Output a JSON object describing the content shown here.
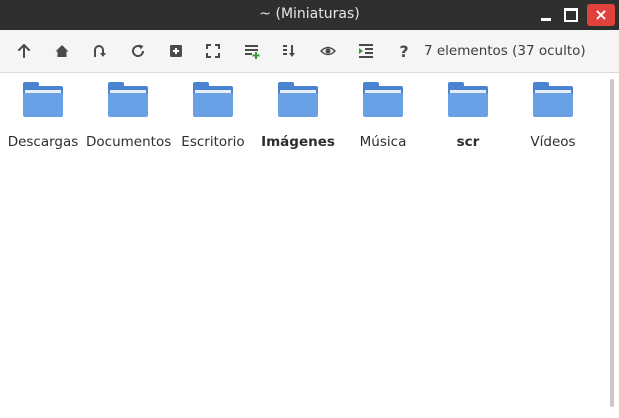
{
  "window": {
    "title": "~ (Miniaturas)",
    "controls": {
      "close_glyph": "×"
    }
  },
  "toolbar": {
    "buttons": [
      {
        "name": "up-button",
        "icon": "arrow-up-icon"
      },
      {
        "name": "home-button",
        "icon": "home-icon"
      },
      {
        "name": "go-back-button",
        "icon": "undo-arrow-icon"
      },
      {
        "name": "reload-button",
        "icon": "reload-icon"
      },
      {
        "name": "new-folder-button",
        "icon": "plus-square-icon"
      },
      {
        "name": "fullscreen-button",
        "icon": "fullscreen-icon"
      },
      {
        "name": "add-bookmark-button",
        "icon": "list-add-icon"
      },
      {
        "name": "sort-button",
        "icon": "sort-down-icon"
      },
      {
        "name": "show-hidden-button",
        "icon": "eye-icon"
      },
      {
        "name": "side-pane-button",
        "icon": "indent-icon"
      },
      {
        "name": "help-button",
        "icon": "question-icon",
        "glyph": "?"
      }
    ],
    "status": "7 elementos (37 oculto)"
  },
  "items": [
    {
      "label": "Descargas",
      "bold": false,
      "icon": "folder-icon"
    },
    {
      "label": "Documentos",
      "bold": false,
      "icon": "folder-icon"
    },
    {
      "label": "Escritorio",
      "bold": false,
      "icon": "folder-icon"
    },
    {
      "label": "Imágenes",
      "bold": true,
      "icon": "folder-icon"
    },
    {
      "label": "Música",
      "bold": false,
      "icon": "folder-icon"
    },
    {
      "label": "scr",
      "bold": true,
      "icon": "folder-icon"
    },
    {
      "label": "Vídeos",
      "bold": false,
      "icon": "folder-icon"
    }
  ],
  "colors": {
    "titlebar": "#2f2f2f",
    "close": "#e0413b",
    "folder_back": "#4a83cf",
    "folder_front": "#6aa0e6",
    "toolbar": "#f5f5f5"
  }
}
